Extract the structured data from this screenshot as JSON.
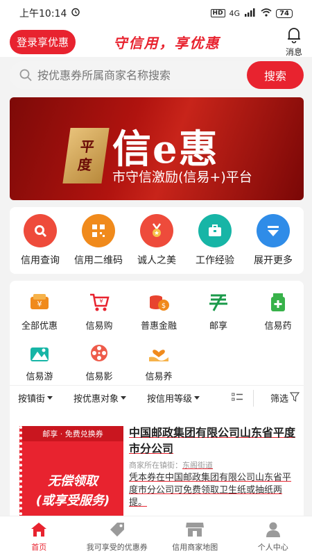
{
  "status": {
    "time": "上午10:14",
    "hd": "HD",
    "network": "4G",
    "battery": "74"
  },
  "header": {
    "login_label": "登录享优惠",
    "slogan": "守信用，享优惠",
    "message_label": "消息"
  },
  "search": {
    "placeholder": "按优惠券所属商家名称搜索",
    "button_label": "搜索"
  },
  "banner": {
    "seal_top": "平",
    "seal_bottom": "度",
    "title": "信e惠",
    "subtitle": "市守信激励(信易+)平台"
  },
  "functions": [
    {
      "label": "信用查询",
      "icon": "search-icon",
      "color": "#ee4b3b"
    },
    {
      "label": "信用二维码",
      "icon": "qrcode-icon",
      "color": "#f08a1c"
    },
    {
      "label": "诚人之美",
      "icon": "medal-icon",
      "color": "#ee4b3b"
    },
    {
      "label": "工作经验",
      "icon": "briefcase-icon",
      "color": "#17b5a6"
    },
    {
      "label": "展开更多",
      "icon": "expand-icon",
      "color": "#2f8ce8"
    }
  ],
  "categories": [
    {
      "label": "全部优惠",
      "icon": "wallet-icon"
    },
    {
      "label": "信易购",
      "icon": "cart-icon"
    },
    {
      "label": "普惠金融",
      "icon": "coins-icon"
    },
    {
      "label": "邮享",
      "icon": "post-icon"
    },
    {
      "label": "信易药",
      "icon": "medicine-icon"
    },
    {
      "label": "信易游",
      "icon": "travel-icon"
    },
    {
      "label": "信易影",
      "icon": "film-icon"
    },
    {
      "label": "信易养",
      "icon": "care-icon"
    }
  ],
  "filters": {
    "street": "按镇街",
    "target": "按优惠对象",
    "level": "按信用等级",
    "filter": "筛选"
  },
  "coupon": {
    "tag": "邮享 · 免费兑换券",
    "main_line1": "无偿领取",
    "main_line2": "(或享受服务)",
    "title": "中国邮政集团有限公司山东省平度市分公司",
    "addr_label": "商家所在镇街：",
    "addr_value": "东阁街道",
    "desc": "凭本券在中国邮政集团有限公司山东省平度市分公司可免费领取卫生纸或抽纸两提。"
  },
  "tabs": [
    {
      "label": "首页",
      "icon": "home-icon"
    },
    {
      "label": "我可享受的优惠券",
      "icon": "tag-icon"
    },
    {
      "label": "信用商家地图",
      "icon": "store-icon"
    },
    {
      "label": "个人中心",
      "icon": "person-icon"
    }
  ],
  "colors": {
    "accent": "#e8232f"
  }
}
